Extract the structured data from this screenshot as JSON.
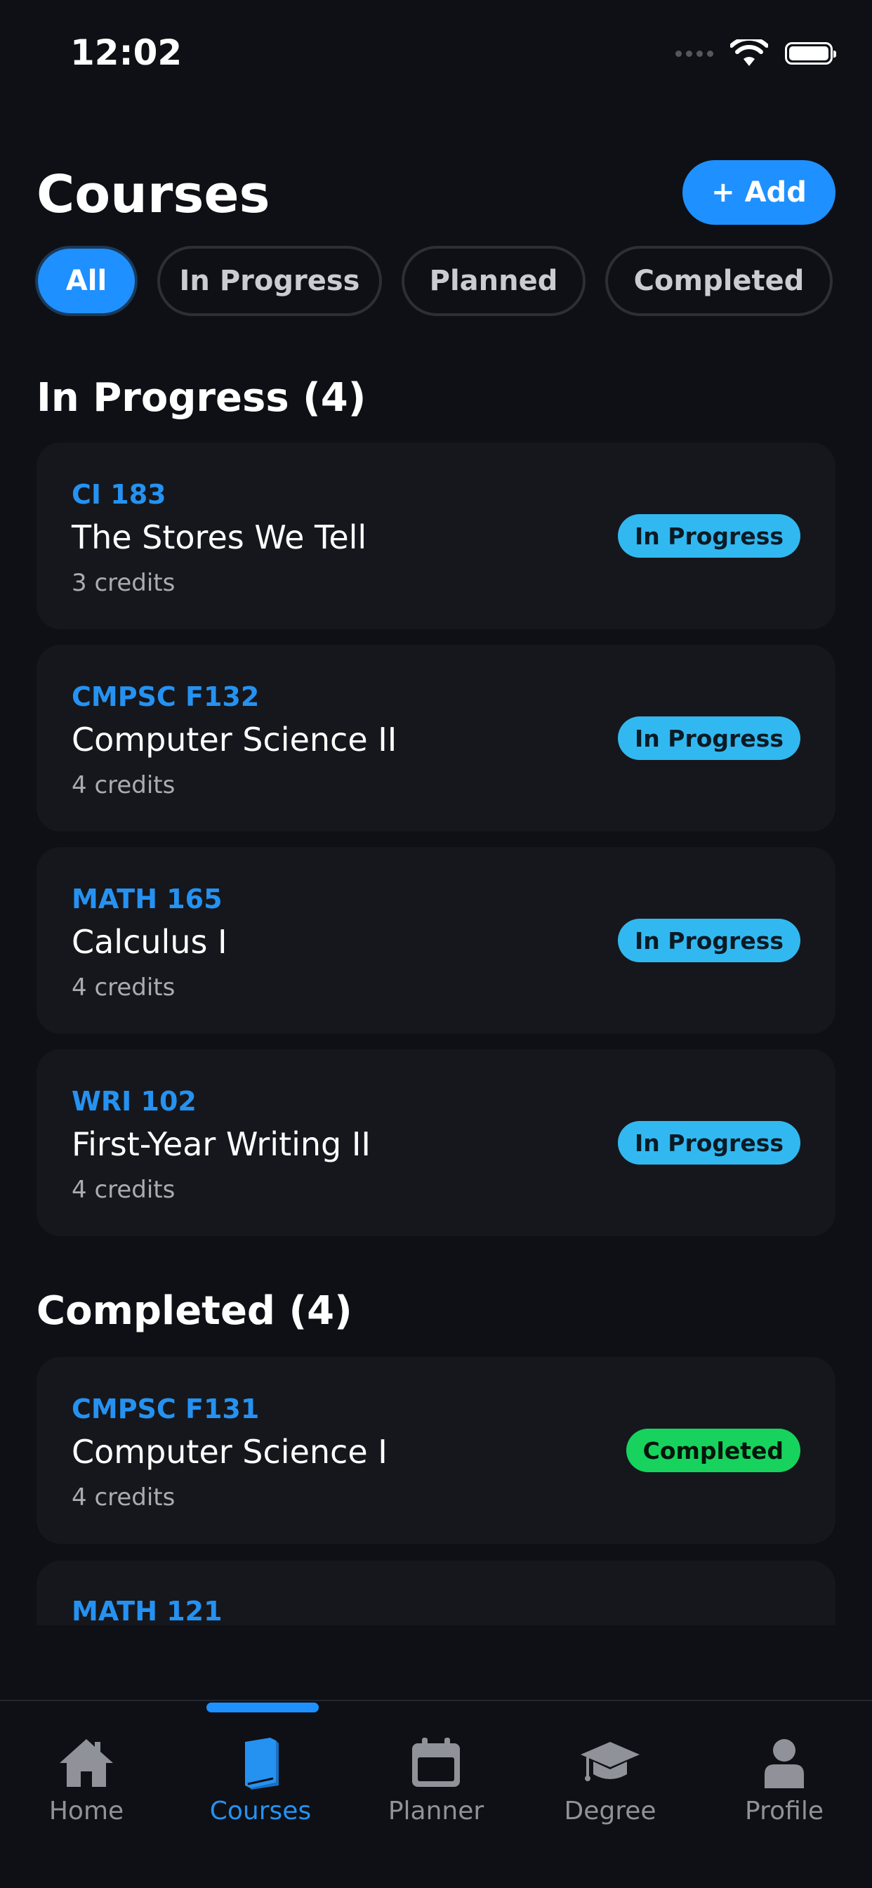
{
  "status_bar": {
    "time": "12:02"
  },
  "header": {
    "title": "Courses",
    "add_label": "+ Add"
  },
  "filters": [
    {
      "label": "All",
      "active": true
    },
    {
      "label": "In Progress",
      "active": false
    },
    {
      "label": "Planned",
      "active": false
    },
    {
      "label": "Completed",
      "active": false
    }
  ],
  "sections": {
    "in_progress": {
      "title": "In Progress (4)",
      "courses": [
        {
          "code": "CI 183",
          "name": "The Stores We Tell",
          "credits": "3 credits",
          "status": "In Progress"
        },
        {
          "code": "CMPSC F132",
          "name": "Computer Science II",
          "credits": "4 credits",
          "status": "In Progress"
        },
        {
          "code": "MATH 165",
          "name": "Calculus I",
          "credits": "4 credits",
          "status": "In Progress"
        },
        {
          "code": "WRI 102",
          "name": "First-Year Writing II",
          "credits": "4 credits",
          "status": "In Progress"
        }
      ]
    },
    "completed": {
      "title": "Completed (4)",
      "courses": [
        {
          "code": "CMPSC F131",
          "name": "Computer Science I",
          "credits": "4 credits",
          "status": "Completed"
        },
        {
          "code": "MATH 121"
        }
      ]
    }
  },
  "tab_bar": [
    {
      "label": "Home",
      "icon": "home-icon",
      "active": false
    },
    {
      "label": "Courses",
      "icon": "book-icon",
      "active": true
    },
    {
      "label": "Planner",
      "icon": "calendar-icon",
      "active": false
    },
    {
      "label": "Degree",
      "icon": "graduation-cap-icon",
      "active": false
    },
    {
      "label": "Profile",
      "icon": "person-icon",
      "active": false
    }
  ],
  "colors": {
    "background": "#0e1015",
    "card": "#15171c",
    "accent": "#1e90ff",
    "in_progress_badge": "#32b8f0",
    "completed_badge": "#17d35e"
  }
}
